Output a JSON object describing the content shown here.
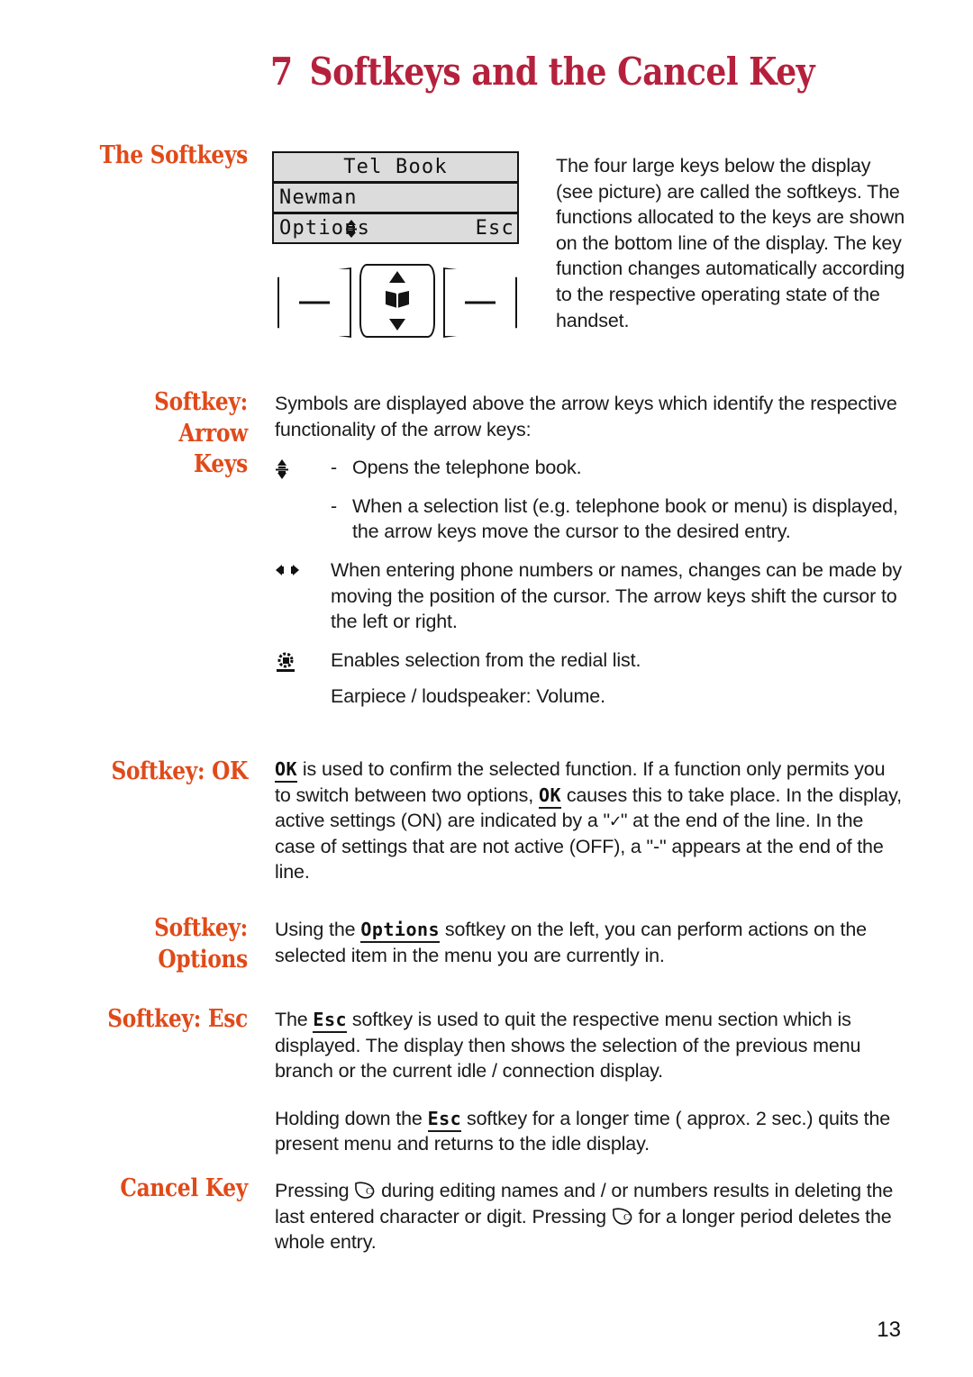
{
  "chapter": {
    "number": "7",
    "title": "Softkeys and the Cancel Key"
  },
  "sections": {
    "softkeys": {
      "heading": "The Softkeys",
      "body": "The four large keys below the display (see picture) are called the softkeys. The functions allocated to the keys are shown on the bottom line of the display. The key function changes automatically according to the respective operating state of the handset."
    },
    "arrow_keys": {
      "heading_line1": "Softkey: Arrow",
      "heading_line2": "Keys",
      "intro": "Symbols are displayed above the arrow keys which identify the respective functionality of the arrow keys:",
      "items": [
        {
          "icon": "updown-arrow-pixel-icon",
          "dash": "-",
          "text": "Opens the telephone book."
        },
        {
          "icon": "none",
          "dash": "-",
          "text": "When a selection list (e.g. telephone book or menu) is displayed, the arrow keys move the cursor to the desired entry."
        },
        {
          "icon": "leftright-arrow-pixel-icon",
          "dash": "",
          "text": "When entering phone numbers or names, changes can be made by moving the position of the cursor. The arrow keys shift the cursor to the left or right."
        },
        {
          "icon": "redial-pixel-icon",
          "dash": "",
          "text": "Enables selection from the redial list."
        }
      ],
      "trailing": "Earpiece / loudspeaker: Volume."
    },
    "softkey_ok": {
      "heading": "Softkey: OK",
      "ok_label": "OK",
      "text_a": " is used to confirm the selected function. If a function only permits you to switch between two options, ",
      "text_b": " causes this to take place. In the display, active settings (ON) are indicated by a \"",
      "check_label": "✓",
      "text_c": "\" at the end of the line. In the case of settings that are not active (OFF), a \"-\" appears at the end of the line."
    },
    "softkey_options": {
      "heading_line1": "Softkey:",
      "heading_line2": "Options",
      "options_label": "Options",
      "text_a": "Using the ",
      "text_b": " softkey on the left, you can perform actions on the selected item in the menu you are currently in."
    },
    "softkey_esc": {
      "heading": "Softkey: Esc",
      "esc_label": "Esc",
      "p1_a": "The ",
      "p1_b": " softkey is used to quit the respective menu section which is displayed. The display then shows the selection of the previous menu branch or the current idle / connection display.",
      "p2_a": "Holding down the ",
      "p2_b": " softkey for a longer time ( approx. 2 sec.) quits the present menu and returns to the idle display."
    },
    "cancel_key": {
      "heading": "Cancel Key",
      "text_a": "Pressing ",
      "text_b": " during editing names and / or numbers results in deleting the last entered character or digit. Pressing ",
      "text_c": " for a longer period deletes the whole entry."
    }
  },
  "figure": {
    "display": {
      "title_line": "Tel Book",
      "entry_line": "Newman",
      "softkey_left": "Options",
      "softkey_middle": "↕",
      "softkey_right": "Esc"
    },
    "keys": {
      "left_key": "—",
      "right_key": "—",
      "middle_key_icon": "telephone-book-icon",
      "up_arrow": "▲",
      "down_arrow": "▼"
    }
  },
  "footer": {
    "page_number": "13"
  },
  "colors": {
    "title": "#b5213c",
    "heading": "#e04a19",
    "text": "#1a1a1a",
    "lcd_background": "#dcdcdc"
  }
}
